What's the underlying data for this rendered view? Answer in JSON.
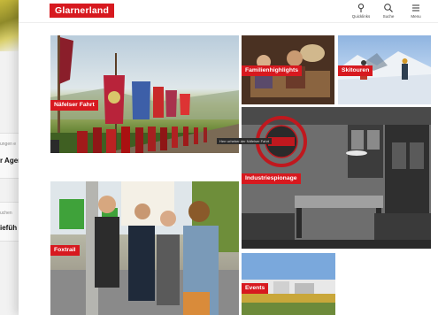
{
  "background_page": {
    "text_small_1": "ungen e",
    "text_bold_1": "r Ager",
    "text_small_2": "uchen",
    "text_bold_2": "iefüh"
  },
  "header": {
    "logo": "Glarnerland",
    "nav": [
      {
        "label": "Quicklinks",
        "icon": "pin-icon"
      },
      {
        "label": "Suche",
        "icon": "search-icon"
      },
      {
        "label": "Menu",
        "icon": "menu-icon"
      }
    ]
  },
  "tiles": [
    {
      "label": "Näfelser Fahrt",
      "caption": "Herr urheber der Näfelser Fahrt"
    },
    {
      "label": "Familienhighlights"
    },
    {
      "label": "Skitouren"
    },
    {
      "label": "Industriespionage"
    },
    {
      "label": "Foxtrail"
    },
    {
      "label": "Events"
    }
  ],
  "colors": {
    "brand_red": "#d7191f"
  }
}
